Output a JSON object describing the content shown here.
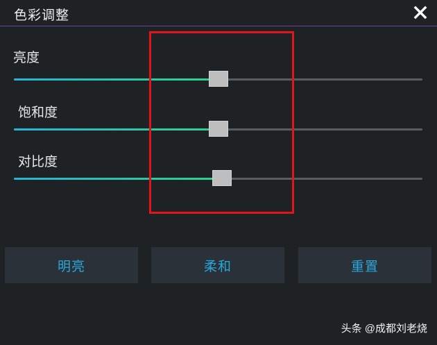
{
  "dialog": {
    "title": "色彩调整",
    "close_icon": "close-icon"
  },
  "sliders": [
    {
      "label": "亮度",
      "value_fraction": 0.5
    },
    {
      "label": "饱和度",
      "value_fraction": 0.5
    },
    {
      "label": "对比度",
      "value_fraction": 0.51
    }
  ],
  "presets": {
    "bright_label": "明亮",
    "soft_label": "柔和",
    "reset_label": "重置"
  },
  "watermark": {
    "text": "头条 @成都刘老烧"
  },
  "colors": {
    "accent": "#27a8dc",
    "highlight": "#e0161b",
    "fill_start": "#27b5d8",
    "fill_end": "#2fd38a"
  }
}
